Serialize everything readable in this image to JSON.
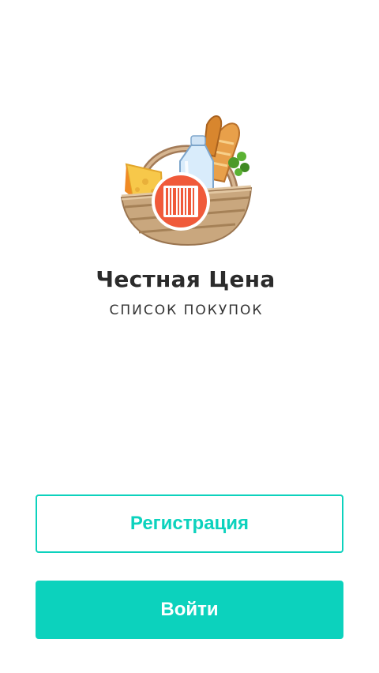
{
  "app": {
    "title": "Честная Цена",
    "subtitle": "СПИСОК ПОКУПОК"
  },
  "actions": {
    "register_label": "Регистрация",
    "login_label": "Войти"
  },
  "logo": {
    "icon": "basket-barcode-icon",
    "accent_color": "#f05a3a"
  },
  "theme": {
    "primary": "#0cd2bd",
    "text": "#2b2b2b",
    "background": "#ffffff"
  }
}
